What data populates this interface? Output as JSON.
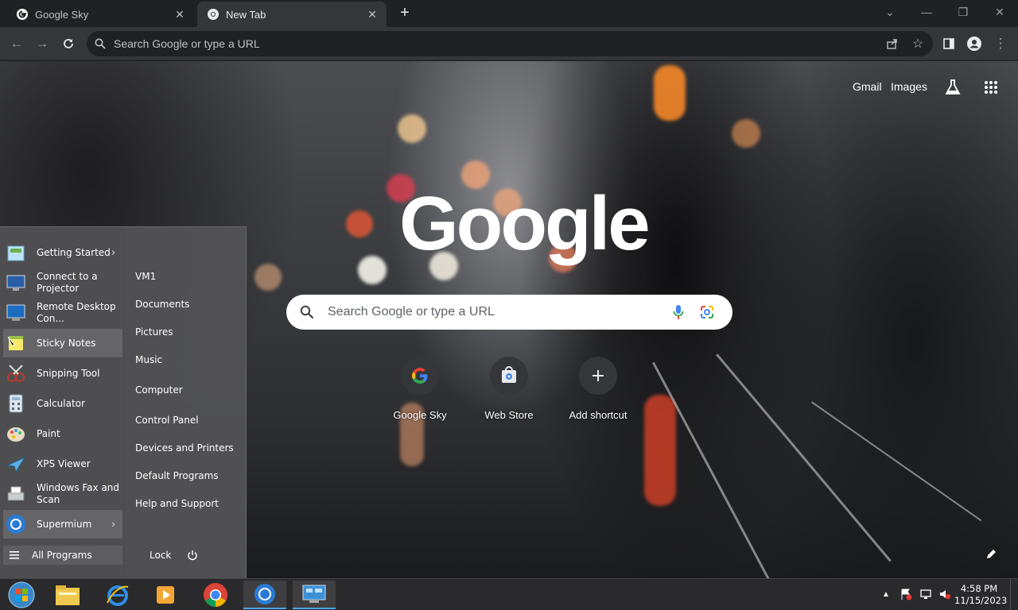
{
  "browser": {
    "tabs": [
      {
        "title": "Google Sky",
        "active": false
      },
      {
        "title": "New Tab",
        "active": true
      }
    ],
    "omnibox_placeholder": "Search Google or type a URL"
  },
  "ntp": {
    "top_links": {
      "gmail": "Gmail",
      "images": "Images"
    },
    "logo_text": "Google",
    "search_placeholder": "Search Google or type a URL",
    "shortcuts": [
      {
        "label": "Google Sky",
        "icon": "google-g-icon"
      },
      {
        "label": "Web Store",
        "icon": "web-store-icon"
      },
      {
        "label": "Add shortcut",
        "icon": "plus-icon"
      }
    ]
  },
  "start_menu": {
    "programs": [
      {
        "label": "Getting Started",
        "icon": "getting-started-icon",
        "submenu": true
      },
      {
        "label": "Connect to a Projector",
        "icon": "projector-icon",
        "submenu": false
      },
      {
        "label": "Remote Desktop Con...",
        "icon": "remote-desktop-icon",
        "submenu": false
      },
      {
        "label": "Sticky Notes",
        "icon": "sticky-notes-icon",
        "submenu": false
      },
      {
        "label": "Snipping Tool",
        "icon": "snipping-tool-icon",
        "submenu": false
      },
      {
        "label": "Calculator",
        "icon": "calculator-icon",
        "submenu": false
      },
      {
        "label": "Paint",
        "icon": "paint-icon",
        "submenu": false
      },
      {
        "label": "XPS Viewer",
        "icon": "xps-viewer-icon",
        "submenu": false
      },
      {
        "label": "Windows Fax and Scan",
        "icon": "fax-scan-icon",
        "submenu": false
      },
      {
        "label": "Supermium",
        "icon": "supermium-icon",
        "submenu": true
      }
    ],
    "places": [
      "VM1",
      "Documents",
      "Pictures",
      "Music",
      "Computer",
      "Control Panel",
      "Devices and Printers",
      "Default Programs",
      "Help and Support"
    ],
    "all_programs": "All Programs",
    "lock": "Lock"
  },
  "taskbar": {
    "apps": [
      "start-orb-icon",
      "explorer-icon",
      "internet-explorer-icon",
      "media-player-icon",
      "chrome-icon",
      "supermium-icon",
      "remote-app-icon"
    ],
    "time": "4:58 PM",
    "date": "11/15/2023"
  },
  "colors": {
    "accent": "#4aa3e8",
    "omnibox_bg": "#202124",
    "toolbar_bg": "#35363a"
  }
}
